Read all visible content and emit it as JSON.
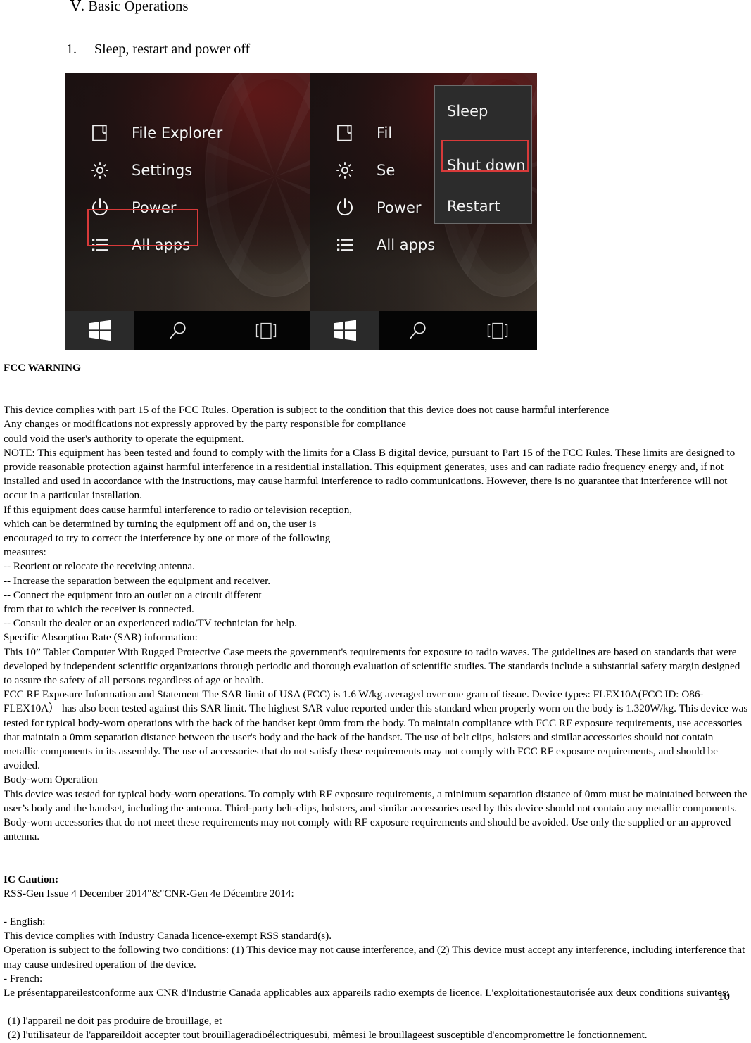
{
  "document": {
    "section_heading": "Ⅴ. Basic Operations",
    "item_number": "1.",
    "item_title": "Sleep, restart and power off",
    "page_number": "10"
  },
  "figure": {
    "left_shot": {
      "start_menu_items": [
        {
          "icon": "file-explorer-icon",
          "label": "File Explorer"
        },
        {
          "icon": "settings-gear-icon",
          "label": "Settings"
        },
        {
          "icon": "power-icon",
          "label": "Power"
        },
        {
          "icon": "all-apps-list-icon",
          "label": "All apps"
        }
      ],
      "highlight": "Power",
      "taskbar": [
        {
          "icon": "windows-start-icon",
          "label": "Start"
        },
        {
          "icon": "search-icon",
          "label": "Search"
        },
        {
          "icon": "task-view-icon",
          "label": "Task View"
        }
      ]
    },
    "right_shot": {
      "power_flyout_items": [
        {
          "label": "Sleep"
        },
        {
          "label": "Shut down"
        },
        {
          "label": "Restart"
        }
      ],
      "highlight": "Shut down",
      "start_menu_items": [
        {
          "icon": "file-explorer-icon",
          "label": "Fil"
        },
        {
          "icon": "settings-gear-icon",
          "label": "Se"
        },
        {
          "icon": "power-icon",
          "label": "Power"
        },
        {
          "icon": "all-apps-list-icon",
          "label": "All apps"
        }
      ],
      "taskbar": [
        {
          "icon": "windows-start-icon",
          "label": "Start"
        },
        {
          "icon": "search-icon",
          "label": "Search"
        },
        {
          "icon": "task-view-icon",
          "label": "Task View"
        }
      ]
    },
    "highlight_color": "#d83a3a"
  },
  "fcc": {
    "heading": "FCC WARNING",
    "lines": [
      "This device complies with part 15 of the FCC Rules. Operation is subject to the condition that this device does not cause harmful interference",
      "Any changes or modifications not expressly approved by the party responsible for compliance",
      "could void the user's authority to operate the equipment.",
      "NOTE: This equipment has been tested and found to comply with the limits for a Class B digital device, pursuant to Part 15 of the FCC Rules. These limits are designed to provide reasonable protection against harmful interference in a residential installation. This equipment generates, uses and can radiate radio frequency energy and, if not installed and used in accordance with the instructions, may cause harmful interference to radio communications. However, there is no guarantee that interference will not occur in a particular installation.",
      "If this equipment does cause harmful interference to radio or television reception,",
      "which can be determined by turning the equipment off and on, the user is",
      "encouraged to try to correct the interference by one or more of the following",
      "measures:",
      "-- Reorient or relocate the receiving antenna.",
      "-- Increase the separation between the equipment and receiver.",
      "-- Connect the equipment into an outlet on a circuit different",
      "from that to which the receiver is connected.",
      "-- Consult the dealer or an experienced radio/TV technician for help.",
      "Specific Absorption Rate (SAR) information:",
      "This 10” Tablet Computer With Rugged Protective Case meets the government's requirements for exposure to radio waves. The guidelines are based on standards that were developed by independent scientific organizations through periodic and thorough evaluation of scientific studies. The standards include a substantial safety margin designed to assure the safety of all persons regardless of age or health.",
      "FCC RF Exposure Information and Statement The SAR limit of USA (FCC) is 1.6 W/kg averaged over one gram of tissue. Device types: FLEX10A(FCC ID: O86-FLEX10A）  has also been tested against this SAR limit. The highest SAR value reported under this standard when properly worn on the body is 1.320W/kg. This device was tested for typical body-worn operations with the back of the handset kept 0mm from the body. To maintain compliance with FCC RF exposure requirements, use accessories that maintain a 0mm separation distance between the user's body and the back of the handset. The use of belt clips, holsters and similar accessories should not contain metallic components in its assembly. The use of accessories that do not satisfy these requirements may not comply with FCC RF exposure requirements, and should be avoided.",
      "Body-worn Operation",
      "This device was tested for typical body-worn operations. To comply with RF exposure requirements, a minimum separation distance of 0mm must be maintained between the user’s body and the handset, including the antenna. Third-party belt-clips, holsters, and similar accessories used by this device should not contain any metallic components. Body-worn accessories that do not meet these requirements may not comply with RF exposure requirements and should be avoided. Use only the supplied or an approved antenna."
    ]
  },
  "ic": {
    "heading": "IC Caution:",
    "rss_line": "RSS-Gen Issue 4 December 2014\"&\"CNR-Gen 4e Décembre 2014:",
    "english_label": "- English:",
    "english_lines": [
      "This device complies with Industry Canada licence-exempt RSS standard(s).",
      "Operation is subject to the following two conditions: (1) This device may not cause interference, and (2) This device must accept any interference, including interference that may cause undesired operation of the device."
    ],
    "french_label": "- French:",
    "french_lines": [
      "Le présentappareilestconforme aux CNR d'Industrie Canada applicables aux appareils radio exempts de licence. L'exploitationestautorisée aux deux conditions suivantes:"
    ],
    "french_conditions": [
      " (1) l'appareil ne doit pas produire de brouillage, et",
      " (2) l'utilisateur de l'appareildoit accepter tout brouillageradioélectriquesubi, mêmesi le brouillageest susceptible d'encompromettre le fonctionnement."
    ]
  }
}
